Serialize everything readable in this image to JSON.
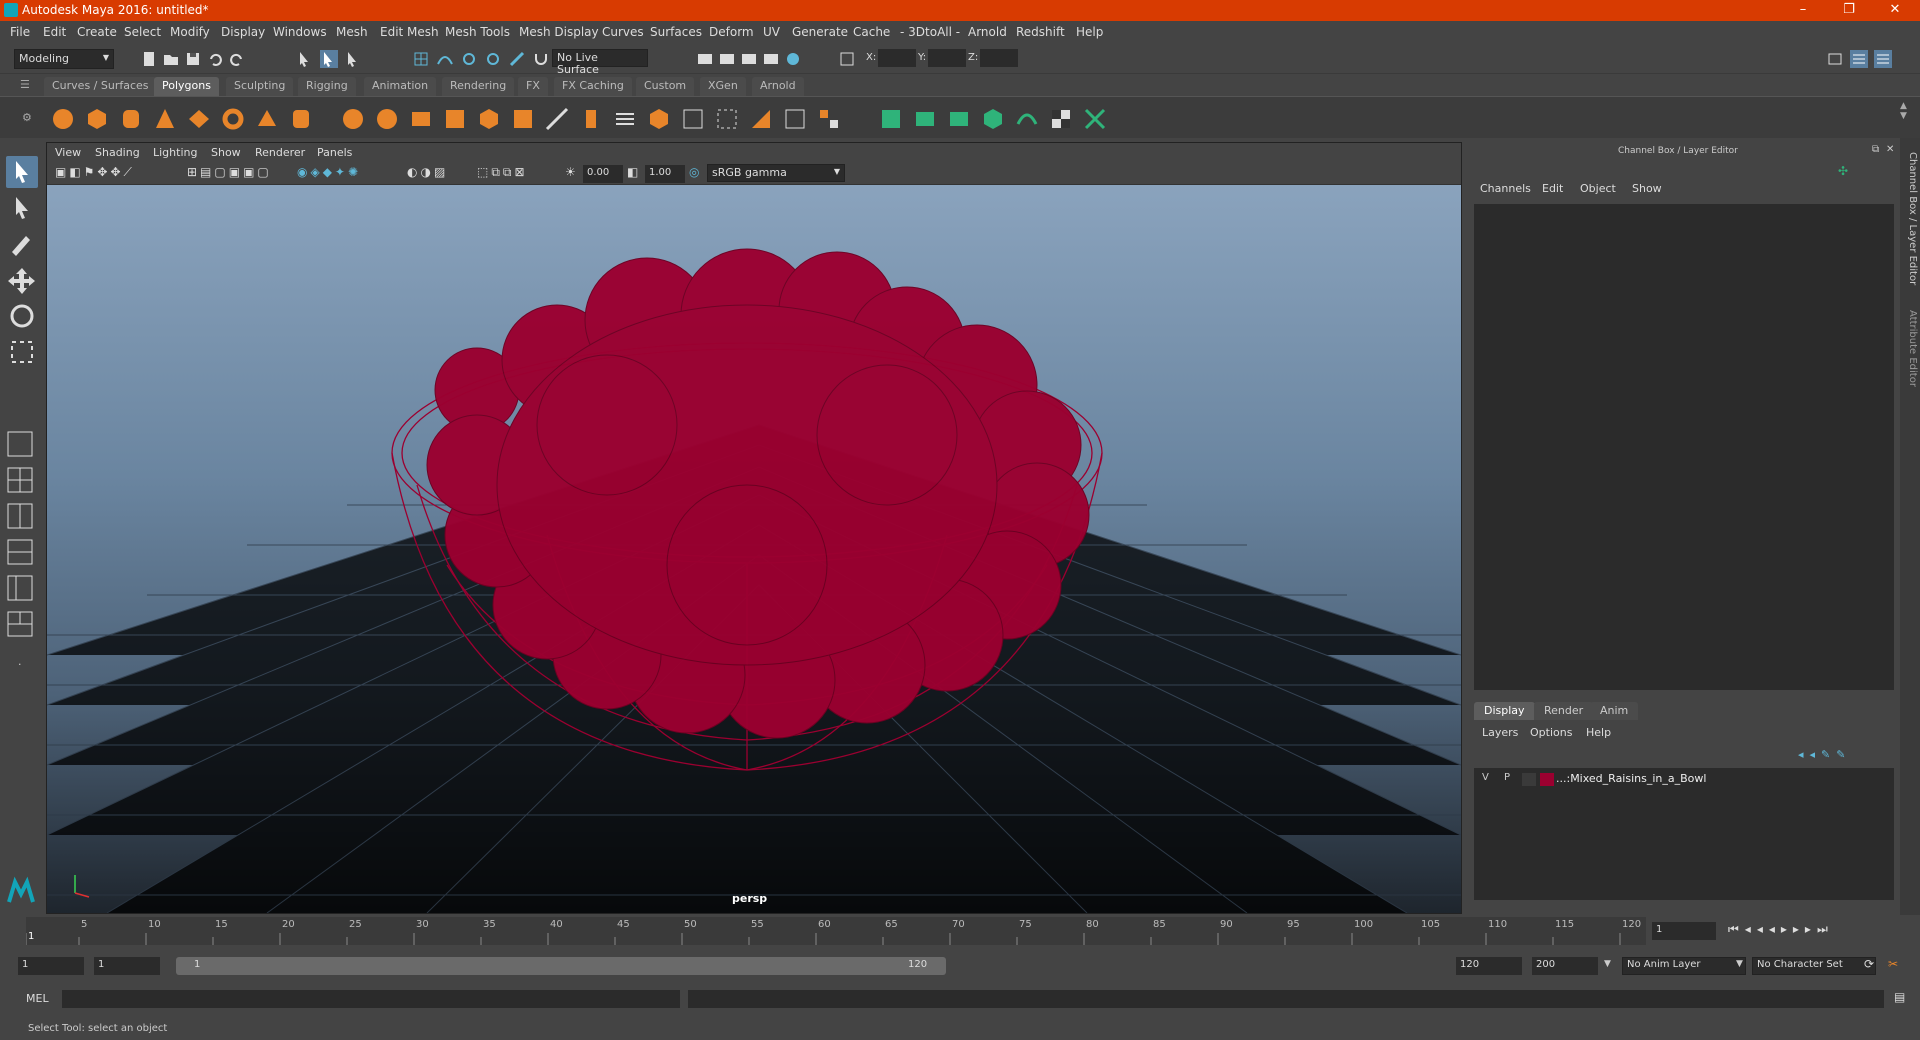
{
  "window": {
    "title": "Autodesk Maya 2016: untitled*",
    "minimize": "–",
    "maximize": "❐",
    "close": "✕"
  },
  "menu": [
    "File",
    "Edit",
    "Create",
    "Select",
    "Modify",
    "Display",
    "Windows",
    "Mesh",
    "Edit Mesh",
    "Mesh Tools",
    "Mesh Display",
    "Curves",
    "Surfaces",
    "Deform",
    "UV",
    "Generate",
    "Cache",
    "- 3DtoAll -",
    "Arnold",
    "Redshift",
    "Help"
  ],
  "status": {
    "mode": "Modeling",
    "live_surface": "No Live Surface",
    "x_label": "X:",
    "y_label": "Y:",
    "z_label": "Z:"
  },
  "shelf_tabs": [
    "Curves / Surfaces",
    "Polygons",
    "Sculpting",
    "Rigging",
    "Animation",
    "Rendering",
    "FX",
    "FX Caching",
    "Custom",
    "XGen",
    "Arnold"
  ],
  "shelf_active": "Polygons",
  "viewport": {
    "menu": [
      "View",
      "Shading",
      "Lighting",
      "Show",
      "Renderer",
      "Panels"
    ],
    "exposure": "0.00",
    "gamma": "1.00",
    "color_space": "sRGB gamma",
    "camera": "persp"
  },
  "channel_box": {
    "title": "Channel Box / Layer Editor",
    "menu": [
      "Channels",
      "Edit",
      "Object",
      "Show"
    ]
  },
  "layer_editor": {
    "tabs": [
      "Display",
      "Render",
      "Anim"
    ],
    "menu": [
      "Layers",
      "Options",
      "Help"
    ],
    "layer": {
      "v": "V",
      "p": "P",
      "name": "...:Mixed_Raisins_in_a_Bowl",
      "color": "#9b0030"
    }
  },
  "side_tabs": [
    "Channel Box / Layer Editor",
    "Attribute Editor"
  ],
  "timeline": {
    "ticks": [
      "5",
      "10",
      "15",
      "20",
      "25",
      "30",
      "35",
      "40",
      "45",
      "50",
      "55",
      "60",
      "65",
      "70",
      "75",
      "80",
      "85",
      "90",
      "95",
      "100",
      "105",
      "110",
      "115",
      "120"
    ],
    "start_label": "1",
    "current_frame": "1"
  },
  "range": {
    "start": "1",
    "playback_start": "1",
    "slider_start": "1",
    "slider_end": "120",
    "end": "120",
    "max": "200",
    "anim_layer": "No Anim Layer",
    "char_set": "No Character Set"
  },
  "cmd": {
    "label": "MEL"
  },
  "help": "Select Tool: select an object",
  "colors": {
    "wire": "#9b0030",
    "titlebar": "#d83b01",
    "accent": "#5fb8d8"
  }
}
